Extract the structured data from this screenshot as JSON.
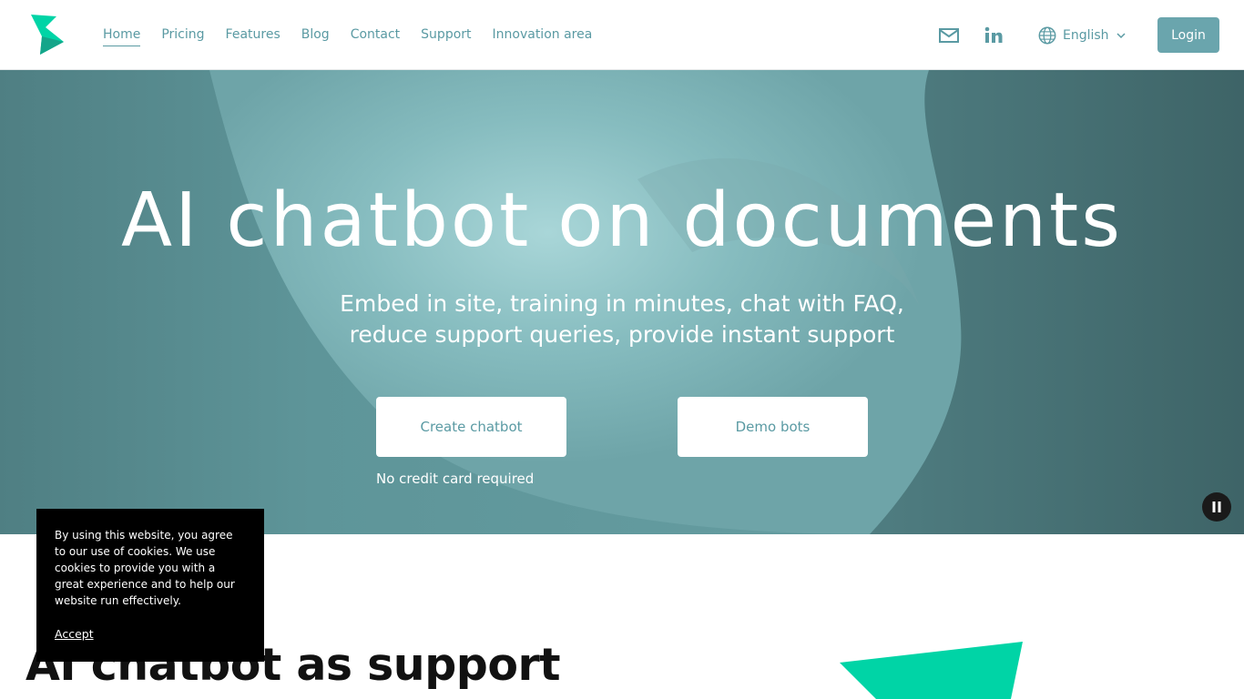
{
  "header": {
    "nav": [
      {
        "label": "Home",
        "active": true
      },
      {
        "label": "Pricing"
      },
      {
        "label": "Features"
      },
      {
        "label": "Blog"
      },
      {
        "label": "Contact"
      },
      {
        "label": "Support"
      },
      {
        "label": "Innovation area"
      }
    ],
    "icons": {
      "email": "mail-icon",
      "linkedin": "linkedin-icon",
      "globe": "globe-icon"
    },
    "language": "English",
    "login_label": "Login"
  },
  "hero": {
    "title": "AI chatbot on documents",
    "subtitle_line1": "Embed in site, training in minutes, chat with FAQ,",
    "subtitle_line2": "reduce support queries, provide instant support",
    "primary_button": "Create chatbot",
    "secondary_button": "Demo bots",
    "note": "No credit card required"
  },
  "section": {
    "title": "AI chatbot as support"
  },
  "cookie": {
    "text": "By using this website, you agree to our use of cookies. We use cookies to provide you with a great experience and to help our website run effectively.",
    "accept": "Accept"
  },
  "colors": {
    "accent": "#5a9aa3",
    "login_bg": "#6aa5ad",
    "brand_green": "#00d4a6",
    "hero_dark": "#436b6f",
    "hero_light": "#8ec3c6"
  }
}
